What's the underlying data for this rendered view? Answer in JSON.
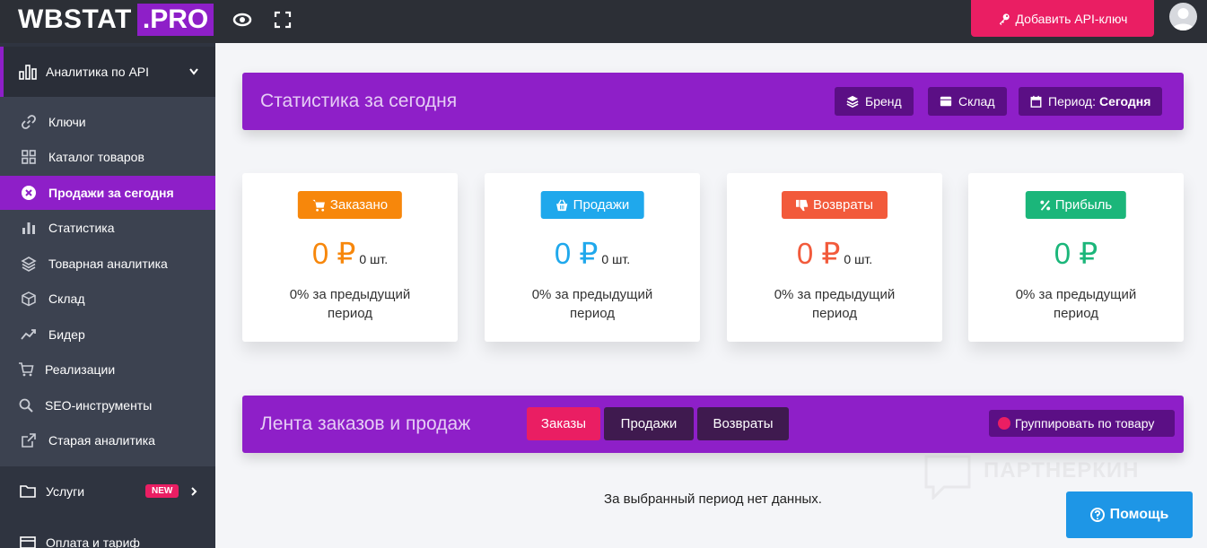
{
  "topbar": {
    "logo_main": "WBSTAT",
    "logo_accent": ".PRO",
    "eye_icon": "eye-icon",
    "fullscreen_icon": "fullscreen-icon",
    "add_api_key_label": "Добавить API-ключ",
    "add_api_key_icon": "key-icon",
    "avatar_icon": "user-avatar"
  },
  "sidebar": {
    "section_label": "Аналитика по API",
    "items": [
      {
        "label": "Ключи",
        "icon": "link-icon"
      },
      {
        "label": "Каталог товаров",
        "icon": "grid-icon"
      },
      {
        "label": "Продажи за сегодня",
        "icon": "circle-x-icon",
        "active": true
      },
      {
        "label": "Статистика",
        "icon": "bar-chart-icon"
      },
      {
        "label": "Товарная аналитика",
        "icon": "layers-icon"
      },
      {
        "label": "Склад",
        "icon": "box-icon"
      },
      {
        "label": "Бидер",
        "icon": "trend-icon"
      },
      {
        "label": "Реализации",
        "icon": "cart-icon"
      },
      {
        "label": "SEO-инструменты",
        "icon": "search-icon"
      },
      {
        "label": "Старая аналитика",
        "icon": "external-link-icon"
      }
    ],
    "services_label": "Услуги",
    "services_badge": "NEW",
    "billing_label": "Оплата и тариф"
  },
  "stats_panel": {
    "title": "Статистика за сегодня",
    "brand_btn": "Бренд",
    "warehouse_btn": "Склад",
    "period_prefix": "Период:",
    "period_value": "Сегодня"
  },
  "cards": [
    {
      "label": "Заказано",
      "color": "#f7870b",
      "amount": "0 ₽",
      "count": "0 шт.",
      "prev": "0% за предыдущий период",
      "icon": "cart-icon"
    },
    {
      "label": "Продажи",
      "color": "#1fa8ec",
      "amount": "0 ₽",
      "count": "0 шт.",
      "prev": "0% за предыдущий период",
      "icon": "basket-icon"
    },
    {
      "label": "Возвраты",
      "color": "#f25a3b",
      "amount": "0 ₽",
      "count": "0 шт.",
      "prev": "0% за предыдущий период",
      "icon": "thumbs-down-icon"
    },
    {
      "label": "Прибыль",
      "color": "#1bb67a",
      "amount": "0 ₽",
      "count": "",
      "prev": "0% за предыдущий период",
      "icon": "percent-icon"
    }
  ],
  "feed_panel": {
    "title": "Лента заказов и продаж",
    "tabs": [
      "Заказы",
      "Продажи",
      "Возвраты"
    ],
    "group_btn": "Группировать по товару"
  },
  "no_data": "За выбранный период нет данных.",
  "help_btn": "Помощь",
  "watermark": "ПАРТНЕРКИН"
}
